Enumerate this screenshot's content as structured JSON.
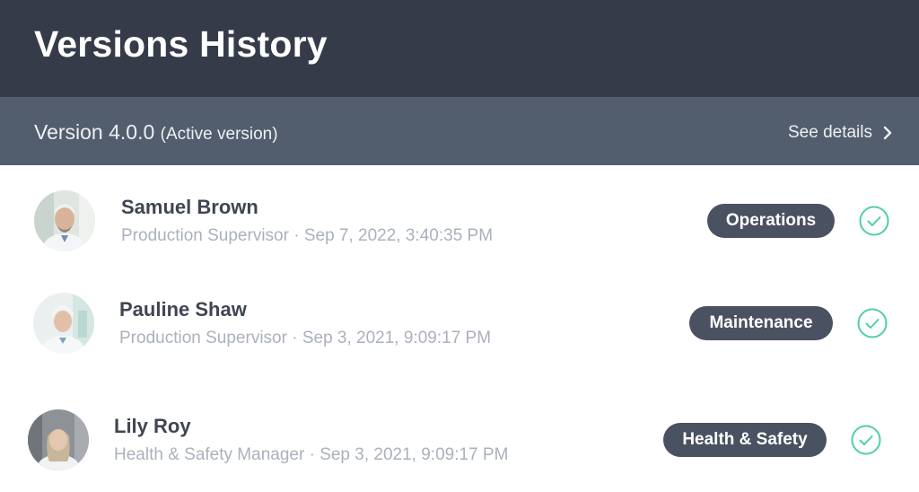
{
  "header": {
    "title": "Versions History"
  },
  "version_bar": {
    "version": "Version 4.0.0",
    "status": "(Active version)",
    "details_link": "See details",
    "details_icon": "chevron-right-icon"
  },
  "entries": [
    {
      "name": "Samuel Brown",
      "role": "Production Supervisor",
      "separator": "·",
      "timestamp": "Sep 7, 2022, 3:40:35 PM",
      "department": "Operations",
      "status_icon": "check-circle-icon"
    },
    {
      "name": "Pauline Shaw",
      "role": "Production Supervisor",
      "separator": "·",
      "timestamp": "Sep 3, 2021, 9:09:17 PM",
      "department": "Maintenance",
      "status_icon": "check-circle-icon"
    },
    {
      "name": "Lily Roy",
      "role": "Health & Safety Manager",
      "separator": "·",
      "timestamp": "Sep 3, 2021, 9:09:17 PM",
      "department": "Health & Safety",
      "status_icon": "check-circle-icon"
    }
  ],
  "colors": {
    "header_bg": "#353b48",
    "version_bar_bg": "#525e6e",
    "badge_bg": "#4a5261",
    "check_accent": "#4fcfa4",
    "meta_text": "#aab1bc"
  }
}
